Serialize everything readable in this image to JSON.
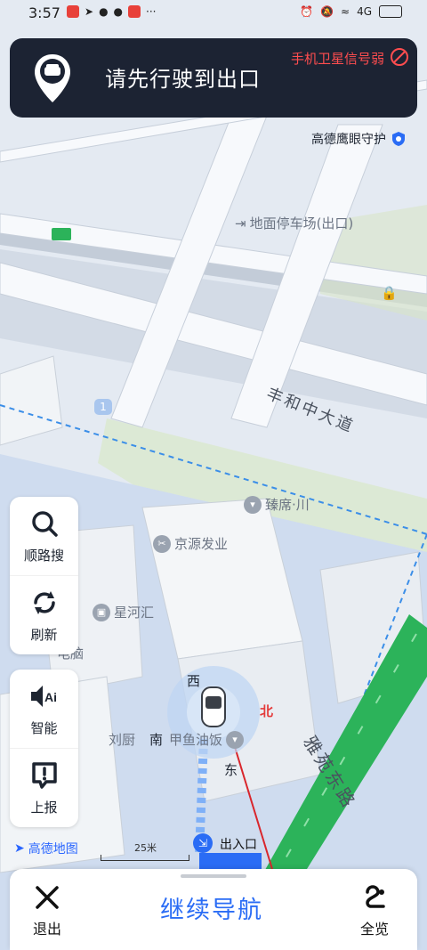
{
  "status_bar": {
    "time": "3:57",
    "network": "4G"
  },
  "banner": {
    "title": "请先行驶到出口",
    "signal_text": "手机卫星信号弱",
    "signal_color": "#ff4d4f",
    "background": "#1c2333"
  },
  "eye_guard": {
    "label": "高德鹰眼守护"
  },
  "map": {
    "poi": {
      "parking": "地面停车场(出口)",
      "zhenxi": "臻席·川",
      "jingyuan": "京源发业",
      "xinghe": "星河汇",
      "liuchu": "刘厨",
      "jiayu": "甲鱼油饭",
      "diannao": "电脑"
    },
    "road_names": {
      "fenghe": "丰和中大道",
      "yayuan": "雅苑东路"
    },
    "route_badge": "1",
    "compass": {
      "west": "西",
      "north": "北",
      "south": "南",
      "east": "东"
    },
    "logo": "高德地图",
    "scale": "25米",
    "exit_label": "出入口",
    "exit_icon": "exit-icon"
  },
  "tools": {
    "search_along": "顺路搜",
    "refresh": "刷新",
    "smart": "智能",
    "report": "上报"
  },
  "bottom_bar": {
    "exit_label": "退出",
    "continue_label": "继续导航",
    "overview_label": "全览"
  },
  "colors": {
    "accent": "#2a6cf5",
    "route_green": "#2cb35a"
  }
}
